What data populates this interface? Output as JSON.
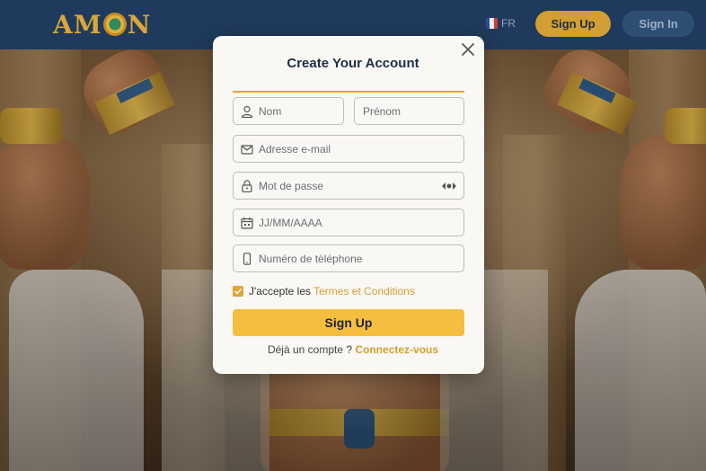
{
  "header": {
    "logo_text_left": "AM",
    "logo_text_right": "N",
    "language": "FR",
    "signup_label": "Sign Up",
    "signin_label": "Sign In"
  },
  "modal": {
    "title": "Create Your Account",
    "fields": {
      "nom": {
        "placeholder": "Nom",
        "icon": "user-icon"
      },
      "prenom": {
        "placeholder": "Prénom"
      },
      "email": {
        "placeholder": "Adresse e-mail",
        "icon": "mail-icon"
      },
      "password": {
        "placeholder": "Mot de passe",
        "icon": "lock-icon"
      },
      "date": {
        "placeholder": "JJ/MM/AAAA",
        "icon": "calendar-icon"
      },
      "phone": {
        "placeholder": "Numéro de tèléphone",
        "icon": "phone-icon"
      }
    },
    "terms_prefix": "J'accepte les",
    "terms_link": "Termes et Conditions",
    "terms_checked": true,
    "submit_label": "Sign Up",
    "login_prompt": "Déjà un compte ?",
    "login_link": "Connectez-vous"
  },
  "colors": {
    "header_bg": "#1f3a5c",
    "accent": "#d39e33",
    "submit_bg": "#f5be3f"
  }
}
